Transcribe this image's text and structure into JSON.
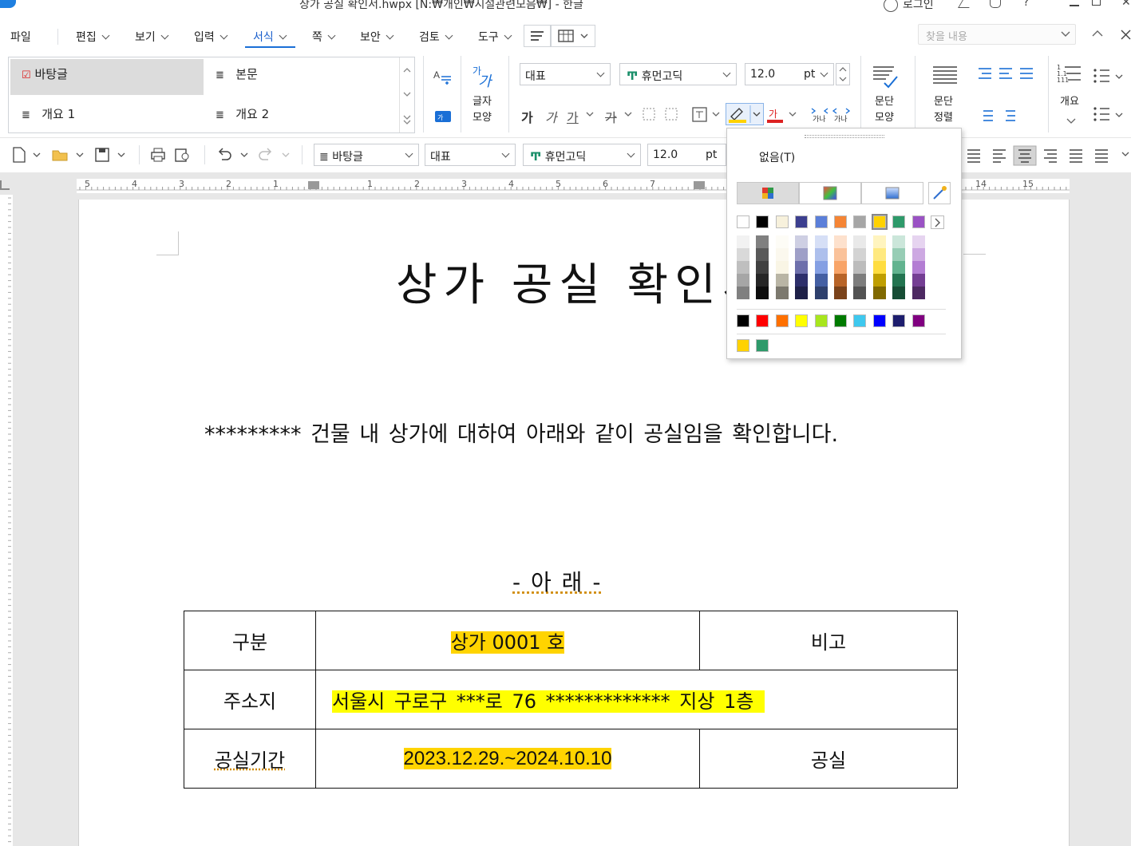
{
  "window": {
    "title": "상가 공실 확인서.hwpx [N:₩개인₩시설관련모음₩] - 한글",
    "login_label": "로그인"
  },
  "menu": {
    "items": [
      "파일",
      "편집",
      "보기",
      "입력",
      "서식",
      "쪽",
      "보안",
      "검토",
      "도구"
    ],
    "active": "서식",
    "find_placeholder": "찾을 내용"
  },
  "ribbon": {
    "styles": [
      "바탕글",
      "본문",
      "개요 1",
      "개요 2"
    ],
    "selected_style": "바탕글",
    "char_shape_label": "글자\n모양",
    "font_group_combo": "대표",
    "font_name": "휴먼고딕",
    "font_size": "12.0",
    "font_unit": "pt",
    "para_shape_label": "문단\n모양",
    "para_align_label": "문단\n정렬",
    "outline_label": "개요",
    "char_buttons": [
      "가",
      "가",
      "가",
      "가"
    ]
  },
  "quickbar": {
    "style_combo": "바탕글",
    "lang_combo": "대표",
    "font_combo": "휴먼고딕",
    "size_combo": "12.0",
    "unit": "pt"
  },
  "ruler": {
    "labels": [
      "5",
      "4",
      "3",
      "2",
      "1",
      "1",
      "2",
      "3",
      "4",
      "5",
      "6",
      "7",
      "14",
      "15"
    ]
  },
  "document": {
    "title": "상가 공실 확인서",
    "body": "********* 건물 내 상가에 대하여 아래와 같이 공실임을 확인합니다.",
    "below_heading": "- 아  래 -",
    "table": {
      "row1": {
        "label": "구분",
        "value": "상가 0001 호",
        "note": "비고"
      },
      "row2": {
        "label": "주소지",
        "value": "서울시 구로구 ***로 76 *************  지상 1층"
      },
      "row3": {
        "label": "공실기간",
        "value": "2023.12.29.~2024.10.10",
        "note": "공실"
      }
    }
  },
  "color_popup": {
    "none_label": "없음(T)",
    "base_colors": [
      "#ffffff",
      "#000000",
      "#f7f1dc",
      "#3c3f8f",
      "#5b7fd9",
      "#f58535",
      "#a6a6a6",
      "#ffd200",
      "#2e9a6a",
      "#9a52c4"
    ],
    "standard_colors": [
      "#000000",
      "#ff0000",
      "#ff7000",
      "#ffff00",
      "#a8e61d",
      "#007a00",
      "#3ec8ee",
      "#0000ff",
      "#1e1e6e",
      "#800080"
    ],
    "recent_colors": [
      "#ffd200",
      "#2e9a6a"
    ]
  }
}
